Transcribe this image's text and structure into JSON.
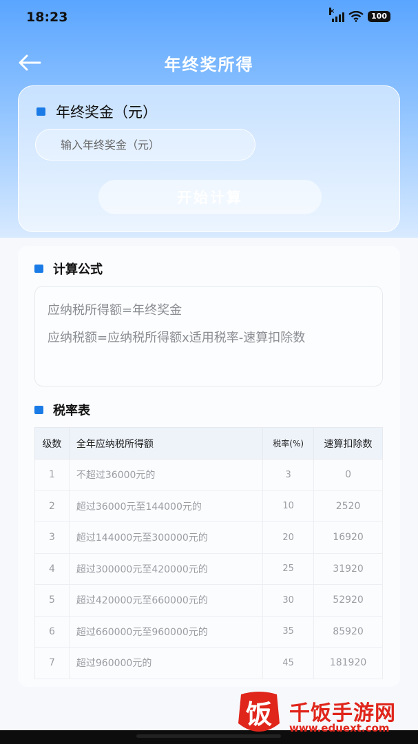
{
  "status": {
    "time": "18:23",
    "battery": "100"
  },
  "nav": {
    "title": "年终奖所得"
  },
  "input_card": {
    "label": "年终奖金（元）",
    "placeholder": "输入年终奖金（元）",
    "button": "开始计算"
  },
  "formula": {
    "label": "计算公式",
    "line1": "应纳税所得额=年终奖金",
    "line2": "应纳税额=应纳税所得额x适用税率-速算扣除数"
  },
  "rate_table": {
    "label": "税率表",
    "headers": [
      "级数",
      "全年应纳税所得额",
      "税率(%)",
      "速算扣除数"
    ],
    "rows": [
      [
        "1",
        "不超过36000元的",
        "3",
        "0"
      ],
      [
        "2",
        "超过36000元至144000元的",
        "10",
        "2520"
      ],
      [
        "3",
        "超过144000元至300000元的",
        "20",
        "16920"
      ],
      [
        "4",
        "超过300000元至420000元的",
        "25",
        "31920"
      ],
      [
        "5",
        "超过420000元至660000元的",
        "30",
        "52920"
      ],
      [
        "6",
        "超过660000元至960000元的",
        "35",
        "85920"
      ],
      [
        "7",
        "超过960000元的",
        "45",
        "181920"
      ]
    ]
  },
  "watermark": {
    "logo_char": "饭",
    "title": "千饭手游网",
    "url": "www.eduext.com"
  },
  "colors": {
    "accent": "#1a7be6",
    "header_top": "#5aa5ff",
    "watermark_red": "#e0251b"
  }
}
